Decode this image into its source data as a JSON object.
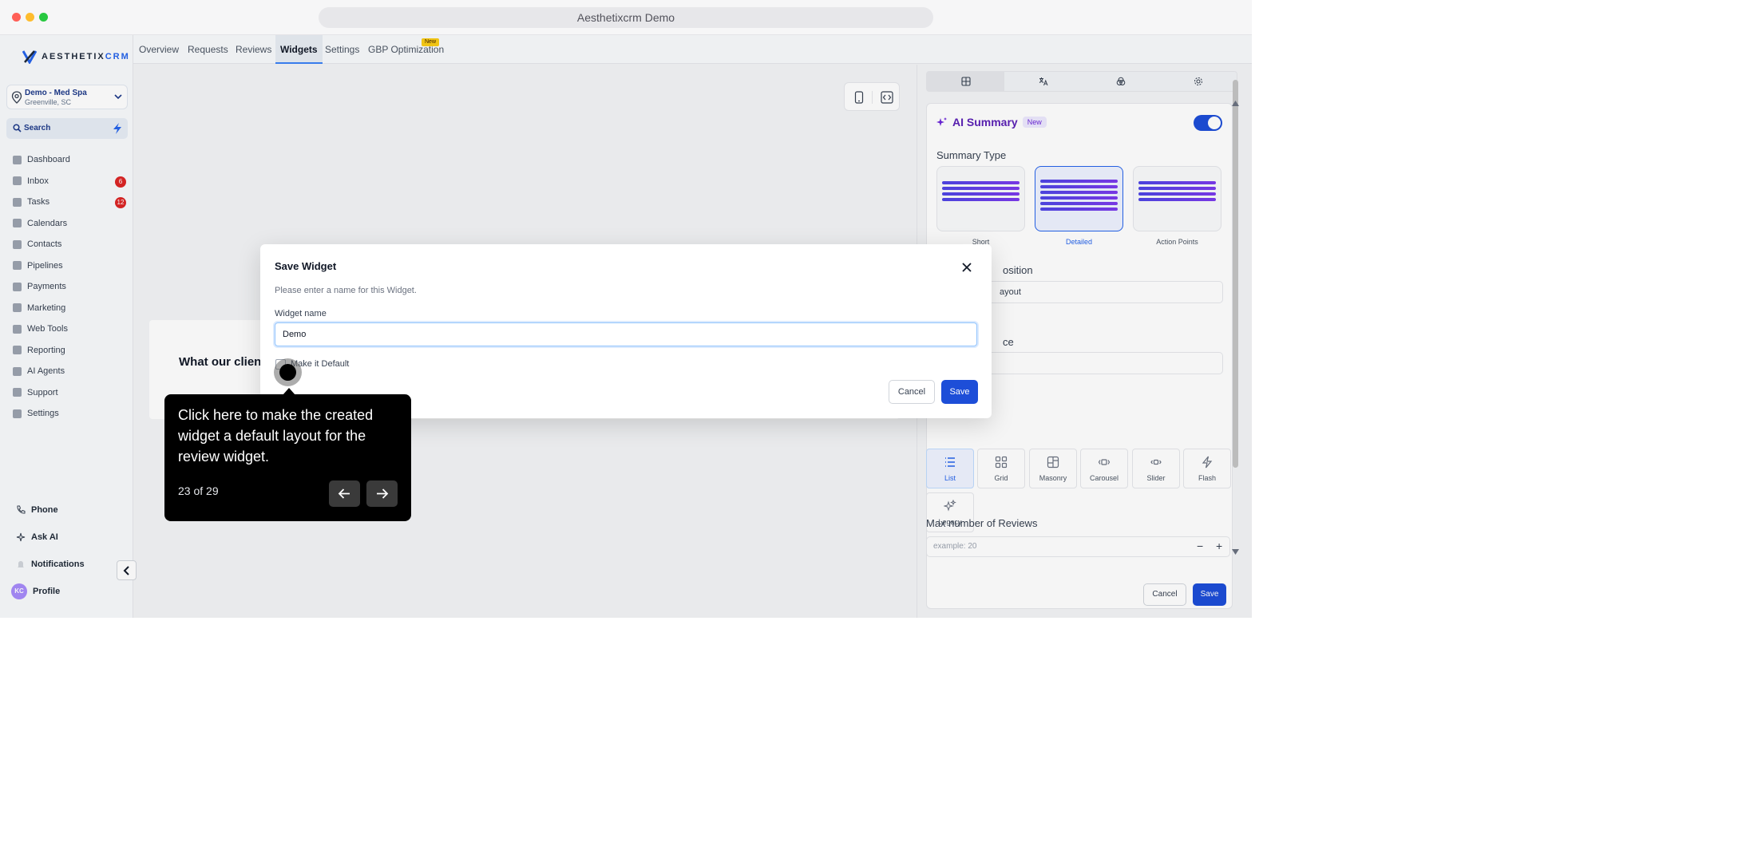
{
  "browser": {
    "url_title": "Aesthetixcrm Demo"
  },
  "logo": {
    "text_main": "AESTHETIX",
    "text_accent": "CRM"
  },
  "location": {
    "name": "Demo - Med Spa",
    "city": "Greenville, SC"
  },
  "search": {
    "label": "Search"
  },
  "nav": {
    "items": [
      {
        "label": "Dashboard",
        "icon": "dashboard-icon"
      },
      {
        "label": "Inbox",
        "icon": "inbox-icon",
        "badge": "6"
      },
      {
        "label": "Tasks",
        "icon": "tasks-icon",
        "badge": "12"
      },
      {
        "label": "Calendars",
        "icon": "calendar-icon"
      },
      {
        "label": "Contacts",
        "icon": "contacts-icon"
      },
      {
        "label": "Pipelines",
        "icon": "pipelines-icon"
      },
      {
        "label": "Payments",
        "icon": "payments-icon"
      },
      {
        "label": "Marketing",
        "icon": "marketing-icon"
      },
      {
        "label": "Web Tools",
        "icon": "web-tools-icon"
      },
      {
        "label": "Reporting",
        "icon": "reporting-icon"
      },
      {
        "label": "AI Agents",
        "icon": "ai-agents-icon"
      },
      {
        "label": "Support",
        "icon": "support-icon"
      },
      {
        "label": "Settings",
        "icon": "settings-icon"
      }
    ]
  },
  "bottom": {
    "phone": "Phone",
    "ask_ai": "Ask AI",
    "notifications": "Notifications",
    "profile": "Profile",
    "avatar_initials": "KC"
  },
  "tabs": {
    "overview": "Overview",
    "requests": "Requests",
    "reviews": "Reviews",
    "widgets": "Widgets",
    "settings": "Settings",
    "gbp": "GBP Optimization",
    "gbp_badge": "New"
  },
  "canvas": {
    "testimonial_title": "What our client"
  },
  "panel": {
    "ai_summary_title": "AI Summary",
    "ai_summary_badge": "New",
    "summary_type_label": "Summary Type",
    "summary_options": [
      "Short",
      "Detailed",
      "Action Points"
    ],
    "position_label": "osition",
    "position_value": "ayout",
    "source_label": "ce",
    "layouts": [
      "List",
      "Grid",
      "Masonry",
      "Carousel",
      "Slider",
      "Flash",
      "Legacy"
    ],
    "max_reviews_label": "Max number of Reviews",
    "max_reviews_placeholder": "example: 20",
    "cancel": "Cancel",
    "save": "Save"
  },
  "modal": {
    "title": "Save Widget",
    "description": "Please enter a name for this Widget.",
    "field_label": "Widget name",
    "field_value": "Demo",
    "checkbox_label": "Make it Default",
    "cancel": "Cancel",
    "save": "Save"
  },
  "guide": {
    "text": "Click here to make the created widget a default layout for the review widget.",
    "step": "23 of 29"
  },
  "colors": {
    "accent": "#1d4ed8",
    "ai_purple": "#5b21b6",
    "badge_red": "#dc2626"
  }
}
